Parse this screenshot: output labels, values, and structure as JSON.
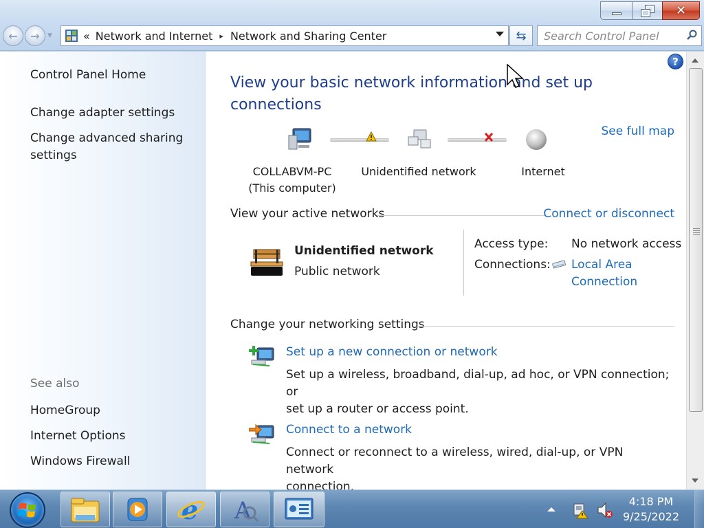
{
  "window": {
    "caption_close": "✕"
  },
  "nav": {
    "back_arrow": "←",
    "forward_arrow": "→"
  },
  "address": {
    "overflow": "«",
    "crumbs": [
      "Network and Internet",
      "Network and Sharing Center"
    ],
    "separator": "▸",
    "refresh_glyph": "⇆"
  },
  "search": {
    "placeholder": "Search Control Panel"
  },
  "sidebar": {
    "home": "Control Panel Home",
    "links": [
      "Change adapter settings",
      "Change advanced sharing",
      "settings"
    ],
    "see_also_heading": "See also",
    "see_also": [
      "HomeGroup",
      "Internet Options",
      "Windows Firewall"
    ]
  },
  "main": {
    "help_glyph": "?",
    "heading_line1": "View your basic network information and set up",
    "heading_line2": "connections",
    "see_full_map": "See full map",
    "map": {
      "computer_name": "COLLABVM-PC",
      "computer_sub": "(This computer)",
      "network": "Unidentified network",
      "internet": "Internet"
    },
    "active_networks": {
      "heading": "View your active networks",
      "action": "Connect or disconnect",
      "name": "Unidentified network",
      "category": "Public network",
      "access_type_label": "Access type:",
      "access_type_value": "No network access",
      "connections_label": "Connections:",
      "connection_line1": "Local Area",
      "connection_line2": "Connection"
    },
    "settings": {
      "heading": "Change your networking settings",
      "tasks": [
        {
          "title": "Set up a new connection or network",
          "desc1": "Set up a wireless, broadband, dial-up, ad hoc, or VPN connection; or",
          "desc2": "set up a router or access point."
        },
        {
          "title": "Connect to a network",
          "desc1": "Connect or reconnect to a wireless, wired, dial-up, or VPN network",
          "desc2": "connection."
        }
      ]
    }
  },
  "taskbar": {
    "clock_time": "4:18 PM",
    "clock_date": "9/25/2022",
    "icons": [
      "windows-explorer-icon",
      "media-player-icon",
      "internet-explorer-icon",
      "paint-icon",
      "control-panel-icon"
    ]
  },
  "colors": {
    "link": "#1e6bb8",
    "heading": "#1e3d8c",
    "warning": "#f2c200",
    "error": "#d42020"
  }
}
